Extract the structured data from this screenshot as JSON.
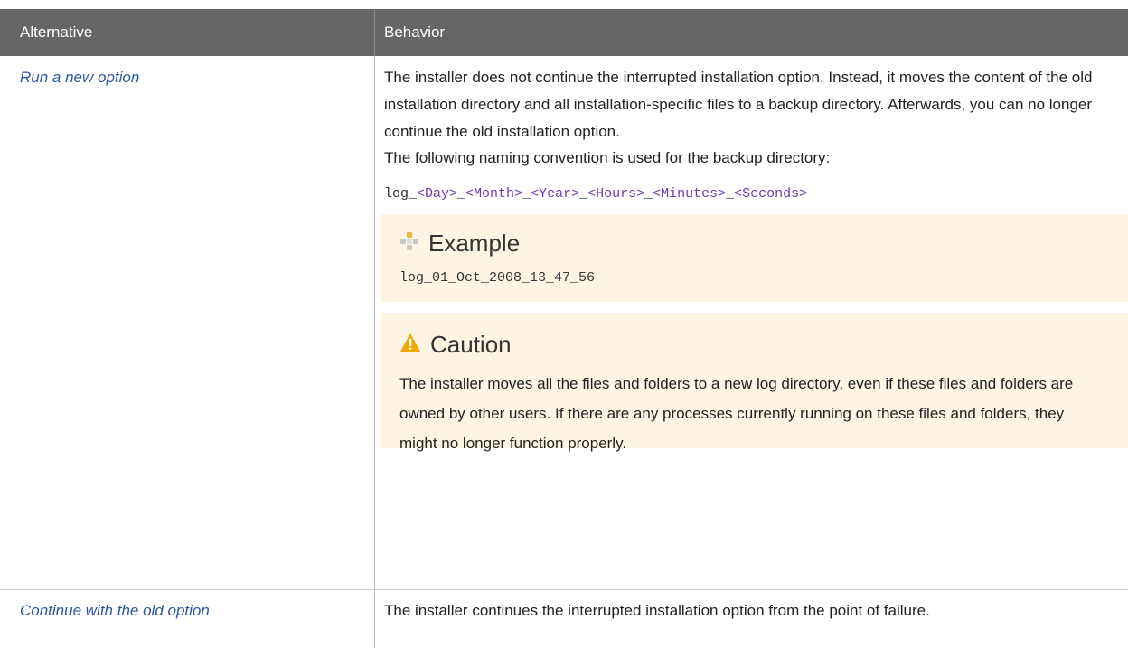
{
  "table": {
    "headers": {
      "alternative": "Alternative",
      "behavior": "Behavior"
    },
    "rows": [
      {
        "alternative": "Run a new option",
        "behavior_text": "The installer does not continue the interrupted installation option. Instead, it moves the content of the old installation directory and all installation-specific files to a backup directory. Afterwards, you can no longer continue the old installation option.",
        "naming_intro": "The following naming convention is used for the backup directory:",
        "naming_pattern": {
          "prefix": "log_",
          "parts": [
            "<Day>",
            "_",
            "<Month>",
            "_",
            "<Year>",
            "_",
            "<Hours>",
            "_",
            "<Minutes>",
            "_",
            "<Seconds>"
          ]
        },
        "example": {
          "title": "Example",
          "icon": "example-icon",
          "code": "log_01_Oct_2008_13_47_56"
        },
        "caution": {
          "title": "Caution",
          "icon": "warning-triangle-icon",
          "text": "The installer moves all the files and folders to a new log directory, even if these files and folders are owned by other users. If there are any processes currently running on these files and folders, they might no longer function properly."
        }
      },
      {
        "alternative": "Continue with the old option",
        "behavior_text": "The installer continues the interrupted installation option from the point of failure."
      }
    ]
  },
  "colors": {
    "header_bg": "#666666",
    "link": "#2b57a0",
    "placeholder": "#6e3bb0",
    "note_bg": "#fdf5e2",
    "warning": "#f0a500"
  }
}
